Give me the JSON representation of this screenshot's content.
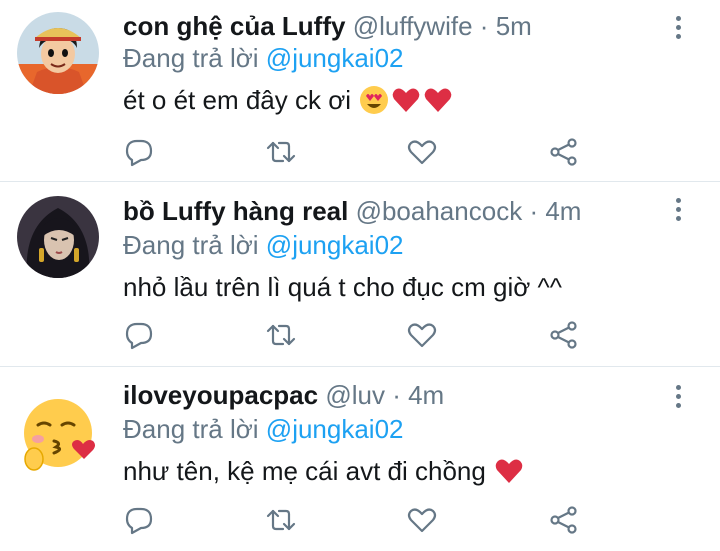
{
  "tweets": [
    {
      "name": "con ghệ của Luffy",
      "handle": "@luffywife",
      "separator": "·",
      "time": "5m",
      "reply_prefix": "Đang trả lời",
      "reply_to": "@jungkai02",
      "text": "ét o ét em đây ck ơi",
      "emojis": [
        "heart-eyes-emoji",
        "red-heart-emoji",
        "red-heart-emoji"
      ],
      "avatar": "luffy-avatar"
    },
    {
      "name": "bồ Luffy hàng real",
      "handle": "@boahancock",
      "separator": "·",
      "time": "4m",
      "reply_prefix": "Đang trả lời",
      "reply_to": "@jungkai02",
      "text": "nhỏ lầu trên lì quá t cho đục cm giờ ^^",
      "emojis": [],
      "avatar": "boa-hancock-avatar"
    },
    {
      "name": "iloveyoupacpac",
      "handle": "@luv",
      "separator": "·",
      "time": "4m",
      "reply_prefix": "Đang trả lời",
      "reply_to": "@jungkai02",
      "text": "như tên, kệ mẹ cái avt đi chồng",
      "emojis": [
        "red-heart-emoji"
      ],
      "avatar": "kissing-heart-emoji-avatar"
    }
  ],
  "icons": {
    "reply": "reply-icon",
    "retweet": "retweet-icon",
    "like": "like-icon",
    "share": "share-icon",
    "more": "more-options-icon"
  },
  "colors": {
    "text": "#14171a",
    "secondary": "#657786",
    "mention": "#1da1f2",
    "divider": "#e1e8ed",
    "heart": "#e0245e"
  }
}
